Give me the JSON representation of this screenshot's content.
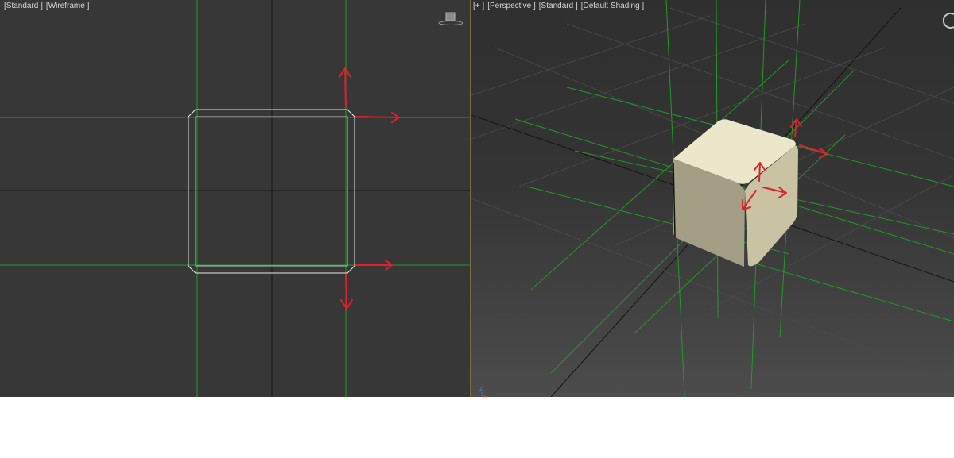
{
  "left_viewport": {
    "labels": [
      "[Standard ]",
      "[Wireframe ]"
    ],
    "view_mode": "wireframe",
    "background_color": "#373737"
  },
  "right_viewport": {
    "labels": [
      "[+ ]",
      "[Perspective ]",
      "[Standard ]",
      "[Default Shading ]"
    ],
    "view_mode": "default-shading",
    "axis_labels": {
      "z": "z"
    }
  },
  "colors": {
    "grid_green": "#1e9e1e",
    "annotation_red": "#e0202a",
    "cube_face": "#e8e1c4",
    "wireframe_white": "#e8e8e8",
    "active_border": "#7a6a3c"
  },
  "icons": [
    "viewcube-icon",
    "navigation-icon",
    "axis-tripod-icon",
    "arrow-annotation-icon"
  ]
}
